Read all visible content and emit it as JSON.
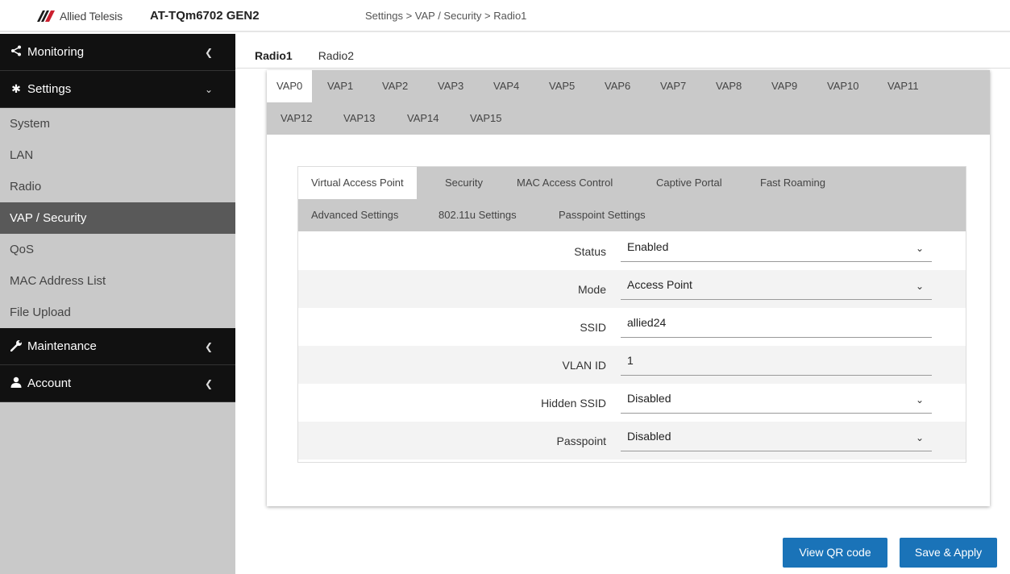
{
  "header": {
    "brand": "Allied Telesis",
    "product": "AT-TQm6702 GEN2",
    "breadcrumb": "Settings > VAP / Security > Radio1",
    "brand_color": "#cc1f2f"
  },
  "sidebar": {
    "monitoring": "Monitoring",
    "settings": "Settings",
    "items": [
      "System",
      "LAN",
      "Radio",
      "VAP / Security",
      "QoS",
      "MAC Address List",
      "File Upload"
    ],
    "active_item": "VAP / Security",
    "maintenance": "Maintenance",
    "account": "Account"
  },
  "radio_tabs": [
    "Radio1",
    "Radio2"
  ],
  "vap_tabs": [
    "VAP0",
    "VAP1",
    "VAP2",
    "VAP3",
    "VAP4",
    "VAP5",
    "VAP6",
    "VAP7",
    "VAP8",
    "VAP9",
    "VAP10",
    "VAP11",
    "VAP12",
    "VAP13",
    "VAP14",
    "VAP15"
  ],
  "inner_tabs": [
    "Virtual Access Point",
    "Security",
    "MAC Access Control",
    "Captive Portal",
    "Fast Roaming",
    "Advanced Settings",
    "802.11u Settings",
    "Passpoint Settings"
  ],
  "form": {
    "status": {
      "label": "Status",
      "value": "Enabled"
    },
    "mode": {
      "label": "Mode",
      "value": "Access Point"
    },
    "ssid": {
      "label": "SSID",
      "value": "allied24"
    },
    "vlan": {
      "label": "VLAN ID",
      "value": "1"
    },
    "hidden": {
      "label": "Hidden SSID",
      "value": "Disabled"
    },
    "passpoint": {
      "label": "Passpoint",
      "value": "Disabled"
    }
  },
  "buttons": {
    "qr": "View QR code",
    "save": "Save & Apply"
  },
  "colors": {
    "primary_button": "#1a73b8",
    "sidebar_dark": "#111111",
    "sidebar_bg": "#c9c9c9"
  }
}
